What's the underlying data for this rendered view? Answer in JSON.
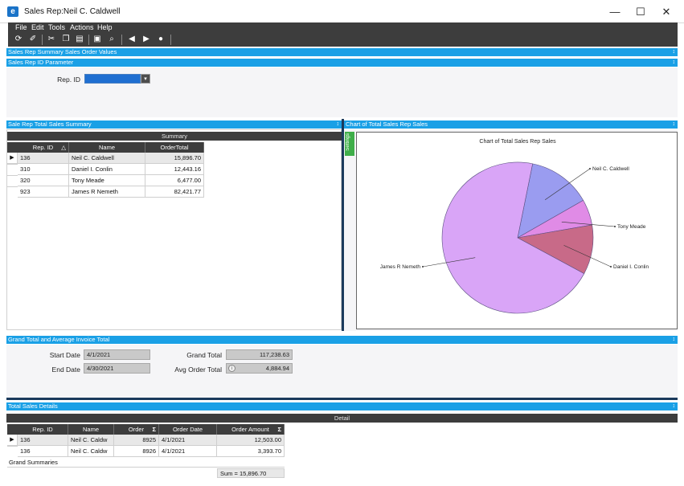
{
  "window": {
    "title": "Sales Rep:Neil C. Caldwell",
    "app_icon": "app-e-icon",
    "minimize": "—",
    "maximize": "☐",
    "close": "✕"
  },
  "menu": [
    "File",
    "Edit",
    "Tools",
    "Actions",
    "Help"
  ],
  "toolbar": {
    "icons": [
      "refresh-icon",
      "clean-icon",
      "cut-icon",
      "copy-icon",
      "paste-icon",
      "print-icon",
      "print-preview-icon",
      "back-icon",
      "forward-icon",
      "stop-icon"
    ]
  },
  "sections": {
    "summary_values": "Sales Rep Summary Sales Order Values",
    "param": "Sales Rep ID Parameter",
    "total_summary": "Sale Rep Total Sales Summary",
    "chart": "Chart of Total Sales Rep Sales",
    "grand_total": "Grand Total and Average Invoice Total",
    "details": "Total Sales Details",
    "pin": "↕"
  },
  "param": {
    "label": "Rep. ID",
    "value": ""
  },
  "summary_grid": {
    "band": "Summary",
    "columns": [
      "Rep. ID",
      "Name",
      "OrderTotal"
    ],
    "sort_icon": "△",
    "rows": [
      {
        "id": "136",
        "name": "Neil C. Caldwell",
        "total": "15,896.70"
      },
      {
        "id": "310",
        "name": "Daniel I. Conlin",
        "total": "12,443.16"
      },
      {
        "id": "320",
        "name": "Tony Meade",
        "total": "6,477.00"
      },
      {
        "id": "923",
        "name": "James R Nemeth",
        "total": "82,421.77"
      }
    ]
  },
  "chart_data": {
    "type": "pie",
    "title": "Chart of Total Sales Rep Sales",
    "side_tab": "Settings",
    "slices": [
      {
        "label": "Neil C. Caldwell",
        "value": 15896.7,
        "color": "#9a9cf0"
      },
      {
        "label": "Tony Meade",
        "value": 6477.0,
        "color": "#e08be6"
      },
      {
        "label": "Daniel I. Conlin",
        "value": 12443.16,
        "color": "#c86a88"
      },
      {
        "label": "James R Nemeth",
        "value": 82421.77,
        "color": "#d9a5f7"
      }
    ]
  },
  "grand": {
    "start_label": "Start Date",
    "start_value": "4/1/2021",
    "end_label": "End Date",
    "end_value": "4/30/2021",
    "total_label": "Grand Total",
    "total_value": "117,238.63",
    "avg_label": "Avg Order Total",
    "avg_value": "4,884.94"
  },
  "detail_grid": {
    "band": "Detail",
    "columns": [
      "Rep. ID",
      "Name",
      "Order",
      "Order Date",
      "Order Amount"
    ],
    "sigma": "Σ",
    "rows": [
      {
        "id": "136",
        "name": "Neil C. Caldw",
        "order": "8925",
        "date": "4/1/2021",
        "amount": "12,503.00"
      },
      {
        "id": "136",
        "name": "Neil C. Caldw",
        "order": "8926",
        "date": "4/1/2021",
        "amount": "3,393.70"
      }
    ],
    "grand_summaries": "Grand Summaries",
    "sum": "Sum = 15,896.70"
  }
}
